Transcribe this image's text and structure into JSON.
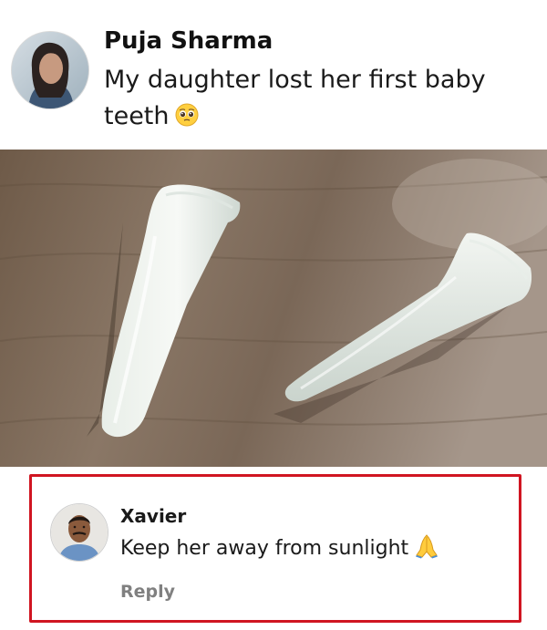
{
  "post": {
    "author": "Puja Sharma",
    "text": "My daughter lost her first baby teeth",
    "text_emoji": "pleading-face-icon",
    "image_description_icon": "teeth-photo"
  },
  "comment": {
    "author": "Xavier",
    "text": "Keep her away from sunlight",
    "text_emoji": "folded-hands-icon",
    "reply_label": "Reply",
    "highlight_color": "#d01521"
  }
}
